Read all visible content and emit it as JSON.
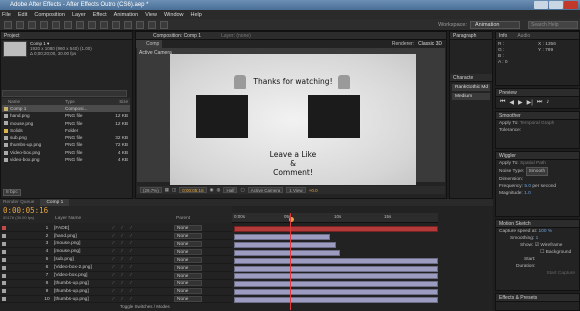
{
  "window": {
    "title": "Adobe After Effects - After Effects Outro (CS6).aep *"
  },
  "menu": [
    "File",
    "Edit",
    "Composition",
    "Layer",
    "Effect",
    "Animation",
    "View",
    "Window",
    "Help"
  ],
  "workspace": {
    "label": "Workspace:",
    "value": "Animation",
    "search_placeholder": "Search Help"
  },
  "project": {
    "tab": "Project",
    "comp_name": "Comp 1 ▾",
    "info_line1": "1920 x 1080 (960 x 540) (1.00)",
    "info_line2": "Δ 0;00;20;00, 30.00 fps",
    "columns": {
      "name": "Name",
      "type": "Type",
      "size": "Size"
    },
    "rows": [
      {
        "name": "Comp 1",
        "type": "Composi...",
        "size": "",
        "selected": true
      },
      {
        "name": "hand.png",
        "type": "PNG file",
        "size": "12 KB"
      },
      {
        "name": "mouse.png",
        "type": "PNG file",
        "size": "12 KB"
      },
      {
        "name": "Solids",
        "type": "Folder",
        "size": ""
      },
      {
        "name": "sub.png",
        "type": "PNG file",
        "size": "32 KB"
      },
      {
        "name": "thumbs-up.png",
        "type": "PNG file",
        "size": "72 KB"
      },
      {
        "name": "Video-box.png",
        "type": "PNG file",
        "size": "4 KB"
      },
      {
        "name": "video-box.png",
        "type": "PNG file",
        "size": "4 KB"
      }
    ],
    "bpc": "8 bpc"
  },
  "composition": {
    "tab": "Composition: Comp 1",
    "tab_sub": "Comp 1",
    "layer_tab": "Layer: (none)",
    "renderer_label": "Renderer:",
    "renderer": "Classic 3D",
    "camera_label": "Active Camera",
    "canvas": {
      "top_text": "Thanks for watching!",
      "bottom_line1": "Leave a Like",
      "bottom_line2": "&",
      "bottom_line3": "Comment!"
    },
    "bar": {
      "zoom": "(29.7%)",
      "time": "0;00:05:16",
      "res": "Half",
      "camera": "Active Camera",
      "views": "1 View",
      "exposure": "+0.0"
    }
  },
  "right": {
    "paragraph_tab": "Paragraph",
    "characters_tab": "Characte",
    "font": "RankGothic Md",
    "style": "Medium",
    "info_tab": "Info",
    "audio_tab": "Audio",
    "info": {
      "r": "R :",
      "g": "G :",
      "b": "B :",
      "a": "A : 0",
      "x": "X : 1356",
      "y": "Y : 799"
    },
    "preview_tab": "Preview",
    "smoother_tab": "Smoother",
    "smoother_apply": "Apply To:",
    "smoother_apply_val": "Temporal Graph",
    "smoother_tol": "Tolerance:",
    "wiggler_tab": "Wiggler",
    "wiggler_apply": "Apply To:",
    "wiggler_apply_val": "Spatial Path",
    "noise_label": "Noise Type:",
    "noise_val": "Smooth",
    "dimension": "Dimension:",
    "freq_label": "Frequency:",
    "freq_val": "5.0",
    "freq_unit": "per second",
    "mag_label": "Magnitude:",
    "mag_val": "1.0",
    "motion_tab": "Motion Sketch",
    "capture_label": "Capture speed at:",
    "capture_val": "100 %",
    "smoothing_label": "Smoothing:",
    "smoothing_val": "1",
    "show_label": "Show:",
    "wireframe": "Wireframe",
    "background": "Background",
    "start": "Start:",
    "duration": "Duration:",
    "start_capture": "Start Capture",
    "effects_tab": "Effects & Presets"
  },
  "timeline": {
    "render_tab": "Render Queue",
    "comp_tab": "Comp 1",
    "current_time": "0:00:05:16",
    "fps_line": "00176 (30.00 fps)",
    "col_layer": "Layer Name",
    "col_parent": "Parent",
    "toggle_label": "Toggle Switches / Modes",
    "ruler_labels": [
      "0:00s",
      "05s",
      "10s",
      "15s"
    ],
    "layers": [
      {
        "num": "1",
        "name": "[FADE]",
        "parent": "None",
        "start": 0.0,
        "end": 1.0,
        "red": true
      },
      {
        "num": "2",
        "name": "[hand.png]",
        "parent": "None",
        "start": 0.0,
        "end": 0.47
      },
      {
        "num": "3",
        "name": "[mouse.png]",
        "parent": "None",
        "start": 0.0,
        "end": 0.5
      },
      {
        "num": "4",
        "name": "[mouse.png]",
        "parent": "None",
        "start": 0.0,
        "end": 0.52
      },
      {
        "num": "5",
        "name": "[sub.png]",
        "parent": "None",
        "start": 0.0,
        "end": 1.0
      },
      {
        "num": "6",
        "name": "[Video-box-2.png]",
        "parent": "None",
        "start": 0.0,
        "end": 1.0
      },
      {
        "num": "7",
        "name": "[Video-box.png]",
        "parent": "None",
        "start": 0.0,
        "end": 1.0
      },
      {
        "num": "8",
        "name": "[thumbs-up.png]",
        "parent": "None",
        "start": 0.0,
        "end": 1.0
      },
      {
        "num": "9",
        "name": "[thumbs-up.png]",
        "parent": "None",
        "start": 0.0,
        "end": 1.0
      },
      {
        "num": "10",
        "name": "[thumbs-up.png]",
        "parent": "None",
        "start": 0.0,
        "end": 1.0
      }
    ]
  }
}
